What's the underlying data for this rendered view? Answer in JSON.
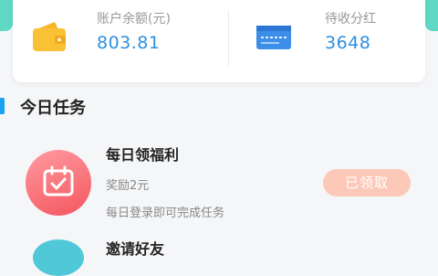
{
  "account": {
    "balance_label": "账户余额(元)",
    "balance_value": "803.81",
    "dividend_label": "待收分红",
    "dividend_value": "3648",
    "balance_icon": "wallet-icon",
    "dividend_icon": "ticket-icon"
  },
  "section": {
    "title": "今日任务"
  },
  "tasks": [
    {
      "icon": "calendar-check-icon",
      "title": "每日领福利",
      "reward": "奖励2元",
      "description": "每日登录即可完成任务",
      "button_label": "已领取",
      "button_color": "#fcc9b9"
    },
    {
      "title": "邀请好友"
    }
  ],
  "colors": {
    "accent_blue": "#2e8fe0",
    "section_bar": "#1aa1f0",
    "task_icon_red": "#f4565f",
    "top_accent": "#5fd8c4"
  }
}
